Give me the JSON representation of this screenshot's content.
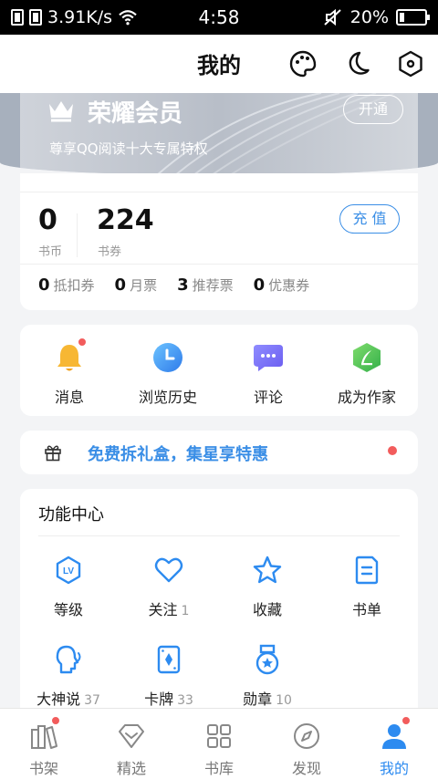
{
  "status_bar": {
    "network_speed": "3.91K/s",
    "time": "4:58",
    "battery": "20%",
    "battery_level": 0.2
  },
  "header": {
    "title": "我的",
    "icons": [
      "palette-icon",
      "moon-icon",
      "settings-hexagon-icon"
    ]
  },
  "vip": {
    "title": "荣耀会员",
    "subtitle": "尊享QQ阅读十大专属特权",
    "open_label": "开通"
  },
  "wallet": {
    "coins": {
      "value": "0",
      "label": "书币"
    },
    "vouchers": {
      "value": "224",
      "label": "书券"
    },
    "recharge_label": "充 值",
    "tickets": [
      {
        "value": "0",
        "label": "抵扣券"
      },
      {
        "value": "0",
        "label": "月票"
      },
      {
        "value": "3",
        "label": "推荐票"
      },
      {
        "value": "0",
        "label": "优惠券"
      }
    ]
  },
  "quick_actions": [
    {
      "label": "消息",
      "icon": "bell-icon",
      "badge": true
    },
    {
      "label": "浏览历史",
      "icon": "clock-icon",
      "badge": false
    },
    {
      "label": "评论",
      "icon": "chat-bubble-icon",
      "badge": false
    },
    {
      "label": "成为作家",
      "icon": "feather-pen-icon",
      "badge": false
    }
  ],
  "promo": {
    "text": "免费拆礼盒，集星享特惠",
    "icon": "gift-icon"
  },
  "function_center": {
    "title": "功能中心",
    "items": [
      {
        "label": "等级",
        "count": "",
        "icon": "level-badge-icon"
      },
      {
        "label": "关注",
        "count": "1",
        "icon": "heart-icon"
      },
      {
        "label": "收藏",
        "count": "",
        "icon": "star-icon"
      },
      {
        "label": "书单",
        "count": "",
        "icon": "booklist-icon"
      },
      {
        "label": "大神说",
        "count": "37",
        "icon": "speaking-head-icon"
      },
      {
        "label": "卡牌",
        "count": "33",
        "icon": "card-icon"
      },
      {
        "label": "勋章",
        "count": "10",
        "icon": "medal-icon"
      }
    ]
  },
  "bottom_nav": [
    {
      "label": "书架",
      "icon": "bookshelf-icon",
      "badge": true,
      "active": false
    },
    {
      "label": "精选",
      "icon": "diamond-icon",
      "badge": false,
      "active": false
    },
    {
      "label": "书库",
      "icon": "grid-icon",
      "badge": false,
      "active": false
    },
    {
      "label": "发现",
      "icon": "compass-icon",
      "badge": false,
      "active": false
    },
    {
      "label": "我的",
      "icon": "user-icon",
      "badge": true,
      "active": true
    }
  ],
  "colors": {
    "accent": "#2d8bf0",
    "badge": "#f25c5c"
  }
}
